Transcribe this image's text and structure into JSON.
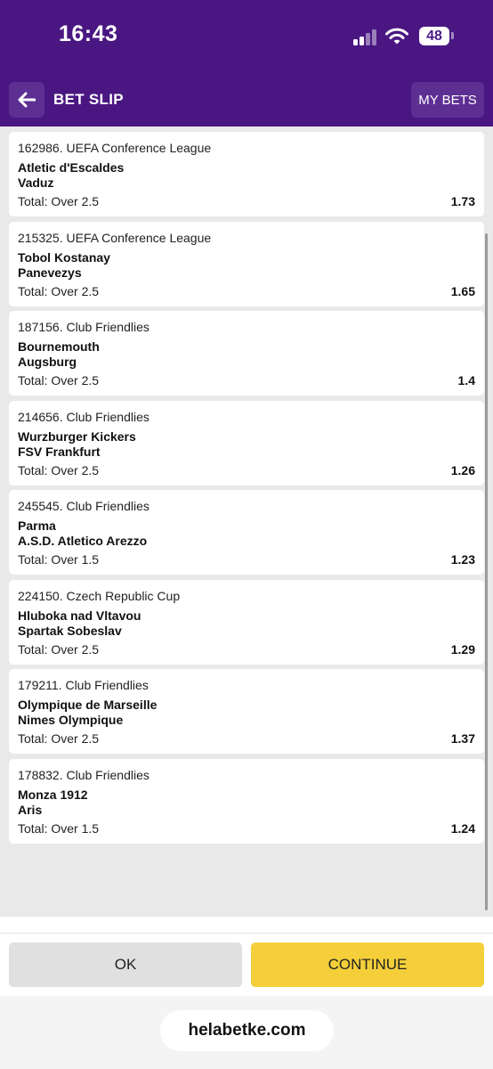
{
  "status_bar": {
    "time": "16:43",
    "battery": "48",
    "signal_icon": "cellular-signal-icon",
    "wifi_icon": "wifi-icon"
  },
  "header": {
    "title": "BET SLIP",
    "my_bets_label": "MY BETS",
    "back_icon": "arrow-left-icon"
  },
  "bets": [
    {
      "league": "162986. UEFA Conference League",
      "team1": "Atletic d'Escaldes",
      "team2": "Vaduz",
      "market": "Total: Over 2.5",
      "odds": "1.73"
    },
    {
      "league": "215325. UEFA Conference League",
      "team1": "Tobol Kostanay",
      "team2": "Panevezys",
      "market": "Total: Over 2.5",
      "odds": "1.65"
    },
    {
      "league": "187156. Club Friendlies",
      "team1": "Bournemouth",
      "team2": "Augsburg",
      "market": "Total: Over 2.5",
      "odds": "1.4"
    },
    {
      "league": "214656. Club Friendlies",
      "team1": "Wurzburger Kickers",
      "team2": "FSV Frankfurt",
      "market": "Total: Over 2.5",
      "odds": "1.26"
    },
    {
      "league": "245545. Club Friendlies",
      "team1": "Parma",
      "team2": "A.S.D. Atletico Arezzo",
      "market": "Total: Over 1.5",
      "odds": "1.23"
    },
    {
      "league": "224150. Czech Republic Cup",
      "team1": "Hluboka nad Vltavou",
      "team2": "Spartak Sobeslav",
      "market": "Total: Over 2.5",
      "odds": "1.29"
    },
    {
      "league": "179211. Club Friendlies",
      "team1": "Olympique de Marseille",
      "team2": "Nimes Olympique",
      "market": "Total: Over 2.5",
      "odds": "1.37"
    },
    {
      "league": "178832. Club Friendlies",
      "team1": "Monza 1912",
      "team2": "Aris",
      "market": "Total: Over 1.5",
      "odds": "1.24"
    }
  ],
  "footer": {
    "ok_label": "OK",
    "continue_label": "CONTINUE"
  },
  "browser": {
    "url": "helabetke.com"
  },
  "colors": {
    "brand_purple": "#4a1782",
    "button_purple": "#5e2f93",
    "continue_yellow": "#f4cf3a",
    "ok_gray": "#e0e0e0",
    "list_bg": "#e9e9e9"
  }
}
